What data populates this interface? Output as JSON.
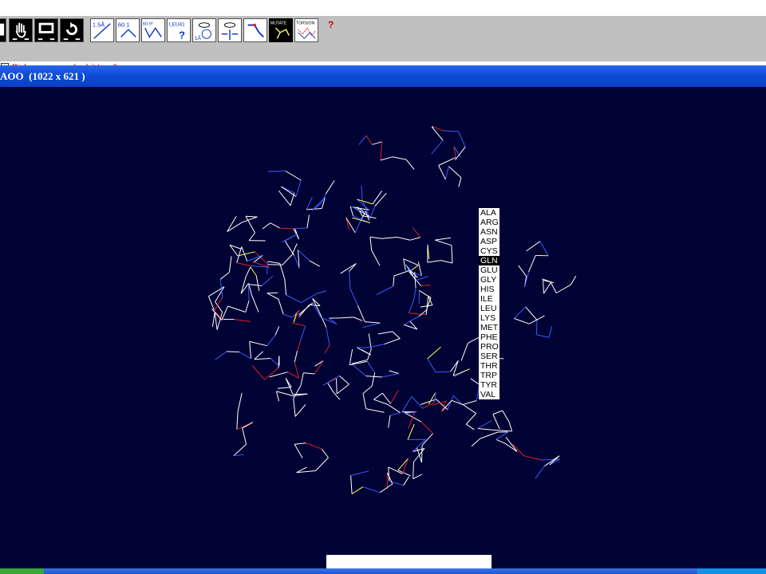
{
  "toolbar": {
    "buttons": [
      {
        "name": "clipped-button",
        "icon": "window-edge-icon",
        "dark": true
      },
      {
        "name": "pan-button",
        "icon": "hand-icon",
        "dark": true
      },
      {
        "name": "zoom-button",
        "icon": "monitor-icon",
        "dark": true
      },
      {
        "name": "rotate-button",
        "icon": "rotate-icon",
        "dark": true
      },
      {
        "name": "distance-button",
        "icon": "distance-icon",
        "label": "1.5Å"
      },
      {
        "name": "angle-button",
        "icon": "angle-icon",
        "label": "60.1"
      },
      {
        "name": "dihedral-button",
        "icon": "dihedral-icon",
        "label": "60.9°"
      },
      {
        "name": "label-button",
        "icon": "label-icon",
        "label": "LEU41"
      },
      {
        "name": "center-button",
        "icon": "eye-icon",
        "label": "1Å"
      },
      {
        "name": "fit-button",
        "icon": "eye-arrows-icon"
      },
      {
        "name": "bond-button",
        "icon": "bond-icon"
      },
      {
        "name": "mutate-button",
        "icon": "mutate-icon",
        "label": "MUTATE",
        "dark": true
      },
      {
        "name": "torsion-button",
        "icon": "torsion-icon",
        "label": "TORSION"
      }
    ],
    "help_icon": "?"
  },
  "status": {
    "text": "Pick one group (or hit 'esc')"
  },
  "window": {
    "title": "AOO  (1022 x 621 )"
  },
  "viewport": {
    "background": "#000333",
    "bond_colors": [
      "#ffffff",
      "#3b5bff",
      "#e02020",
      "#ffff60"
    ]
  },
  "residue_menu": {
    "items": [
      "ALA",
      "ARG",
      "ASN",
      "ASP",
      "CYS",
      "GLN",
      "GLU",
      "GLY",
      "HIS",
      "ILE",
      "LEU",
      "LYS",
      "MET",
      "PHE",
      "PRO",
      "SER",
      "THR",
      "TRP",
      "TYR",
      "VAL"
    ],
    "selected": "GLN"
  },
  "colors": {
    "titlebar": "#0e4bd6",
    "toolbar": "#c0c0c0",
    "status_text": "#e00000"
  }
}
